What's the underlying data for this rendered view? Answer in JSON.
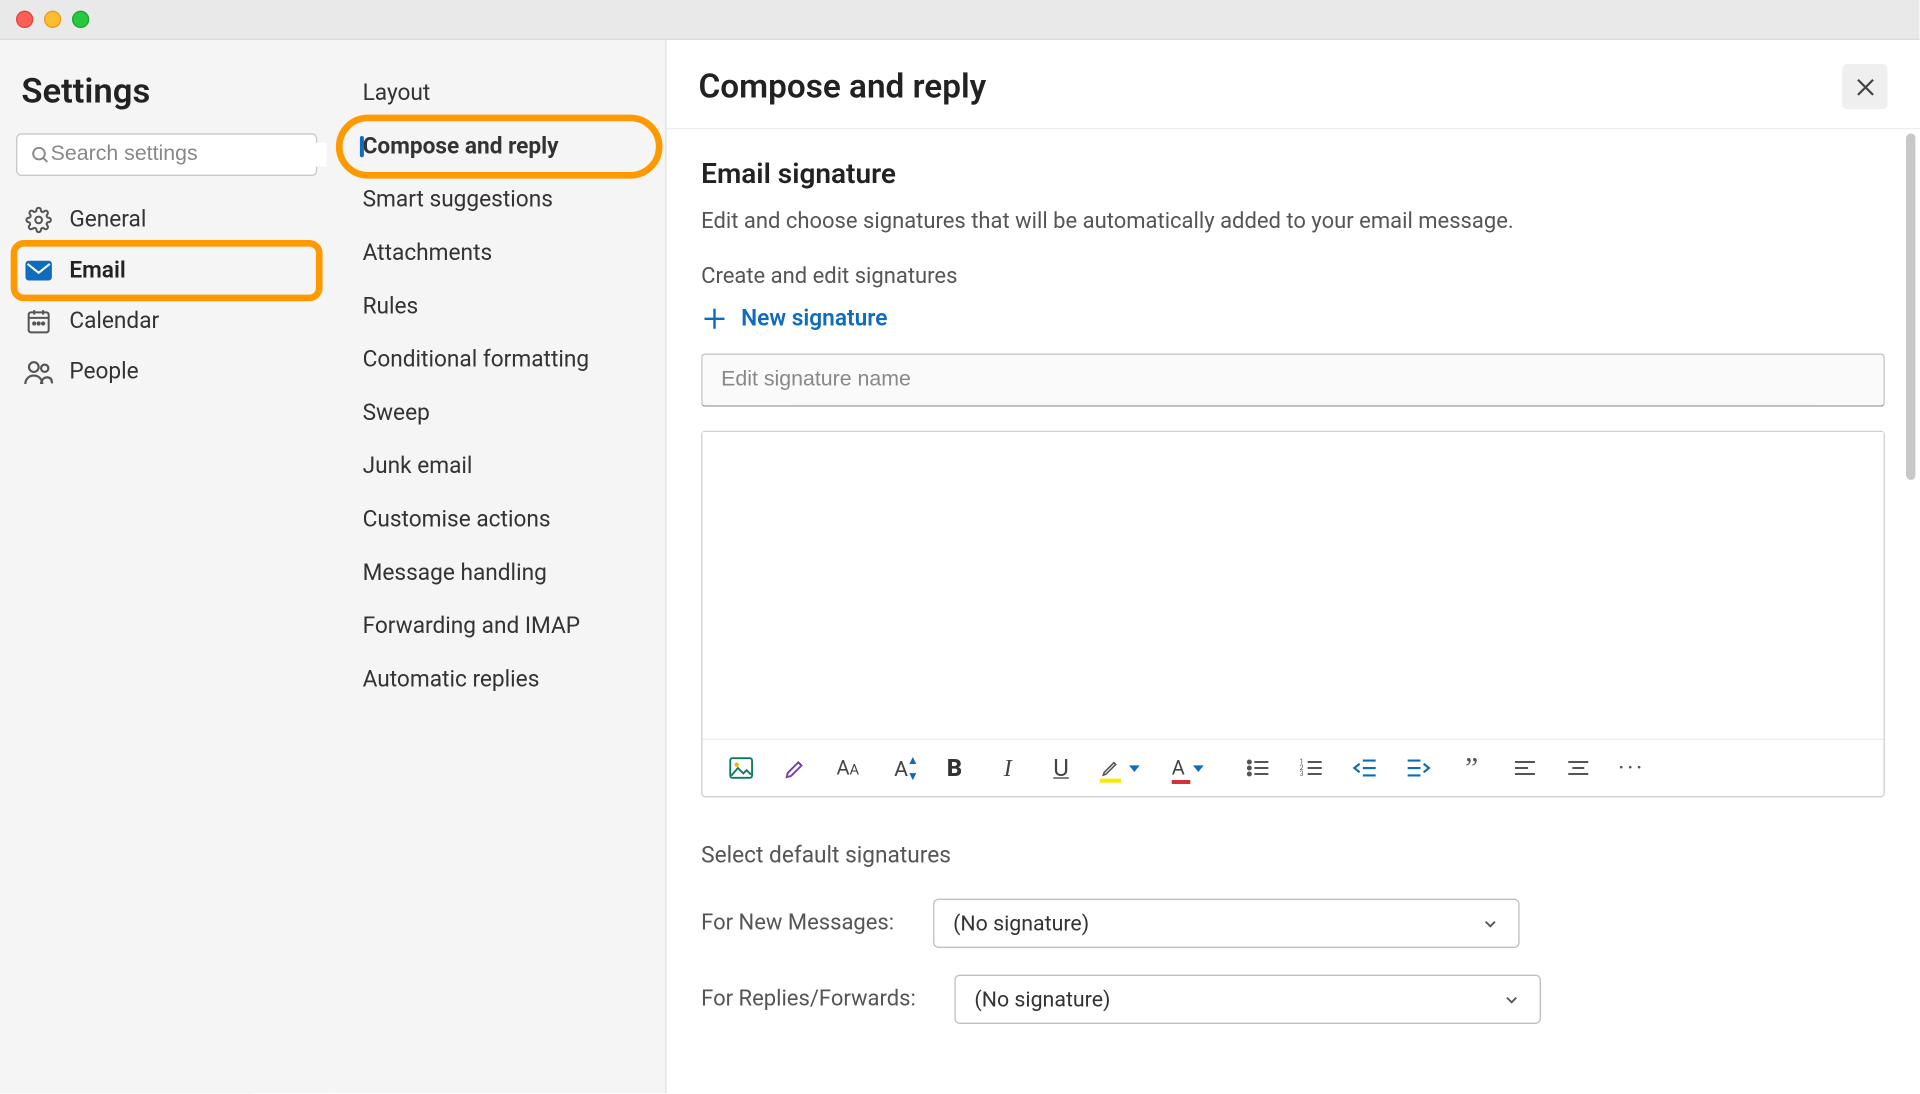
{
  "window": {
    "title": "Settings"
  },
  "search": {
    "placeholder": "Search settings"
  },
  "nav1": [
    {
      "label": "General",
      "icon": "gear-icon",
      "selected": false,
      "highlight": false
    },
    {
      "label": "Email",
      "icon": "mail-icon",
      "selected": true,
      "highlight": true
    },
    {
      "label": "Calendar",
      "icon": "calendar-icon",
      "selected": false,
      "highlight": false
    },
    {
      "label": "People",
      "icon": "people-icon",
      "selected": false,
      "highlight": false
    }
  ],
  "nav2": [
    {
      "label": "Layout",
      "selected": false,
      "highlight": false
    },
    {
      "label": "Compose and reply",
      "selected": true,
      "highlight": true
    },
    {
      "label": "Smart suggestions",
      "selected": false,
      "highlight": false
    },
    {
      "label": "Attachments",
      "selected": false,
      "highlight": false
    },
    {
      "label": "Rules",
      "selected": false,
      "highlight": false
    },
    {
      "label": "Conditional formatting",
      "selected": false,
      "highlight": false
    },
    {
      "label": "Sweep",
      "selected": false,
      "highlight": false
    },
    {
      "label": "Junk email",
      "selected": false,
      "highlight": false
    },
    {
      "label": "Customise actions",
      "selected": false,
      "highlight": false
    },
    {
      "label": "Message handling",
      "selected": false,
      "highlight": false
    },
    {
      "label": "Forwarding and IMAP",
      "selected": false,
      "highlight": false
    },
    {
      "label": "Automatic replies",
      "selected": false,
      "highlight": false
    }
  ],
  "page": {
    "title": "Compose and reply",
    "section_title": "Email signature",
    "help": "Edit and choose signatures that will be automatically added to your email message.",
    "sub": "Create and edit signatures",
    "new_signature": "New signature",
    "signame_placeholder": "Edit signature name",
    "defaults_title": "Select default signatures",
    "new_messages_label": "For New Messages:",
    "replies_label": "For Replies/Forwards:",
    "no_signature": "(No signature)"
  },
  "toolbar": [
    "image-icon",
    "highlighter-icon",
    "font-family-icon",
    "font-size-icon",
    "bold-icon",
    "italic-icon",
    "underline-icon",
    "text-highlight-color-icon",
    "font-color-icon",
    "bullet-list-icon",
    "number-list-icon",
    "outdent-icon",
    "indent-icon",
    "quote-icon",
    "align-left-icon",
    "align-center-icon",
    "more-icon"
  ]
}
